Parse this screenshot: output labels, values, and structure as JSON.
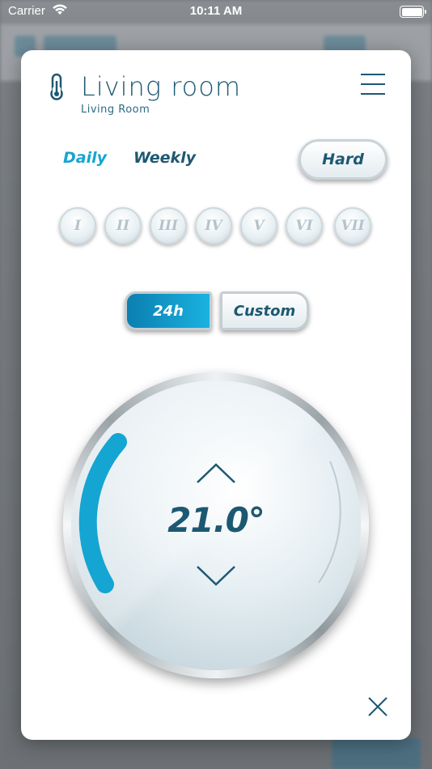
{
  "status_bar": {
    "carrier": "Carrier",
    "time": "10:11 AM",
    "wifi_icon": "wifi-icon",
    "battery_icon": "battery-icon"
  },
  "header": {
    "title": "Living room",
    "subtitle": "Living Room",
    "thermometer_icon": "thermometer-icon",
    "menu_icon": "hamburger-menu-icon"
  },
  "schedule_tabs": {
    "daily": "Daily",
    "weekly": "Weekly",
    "active": "Daily"
  },
  "mode_button": {
    "label": "Hard"
  },
  "days": [
    "I",
    "II",
    "III",
    "IV",
    "V",
    "VI",
    "VII"
  ],
  "range": {
    "option_24h": "24h",
    "option_custom": "Custom",
    "selected": "24h"
  },
  "thermostat": {
    "temperature": "21.0°",
    "up_icon": "chevron-up-icon",
    "down_icon": "chevron-down-icon",
    "arc_color": "#14a5d3"
  },
  "close_icon": "close-icon",
  "colors": {
    "accent": "#14a5d3",
    "primary_text": "#1d5872"
  }
}
